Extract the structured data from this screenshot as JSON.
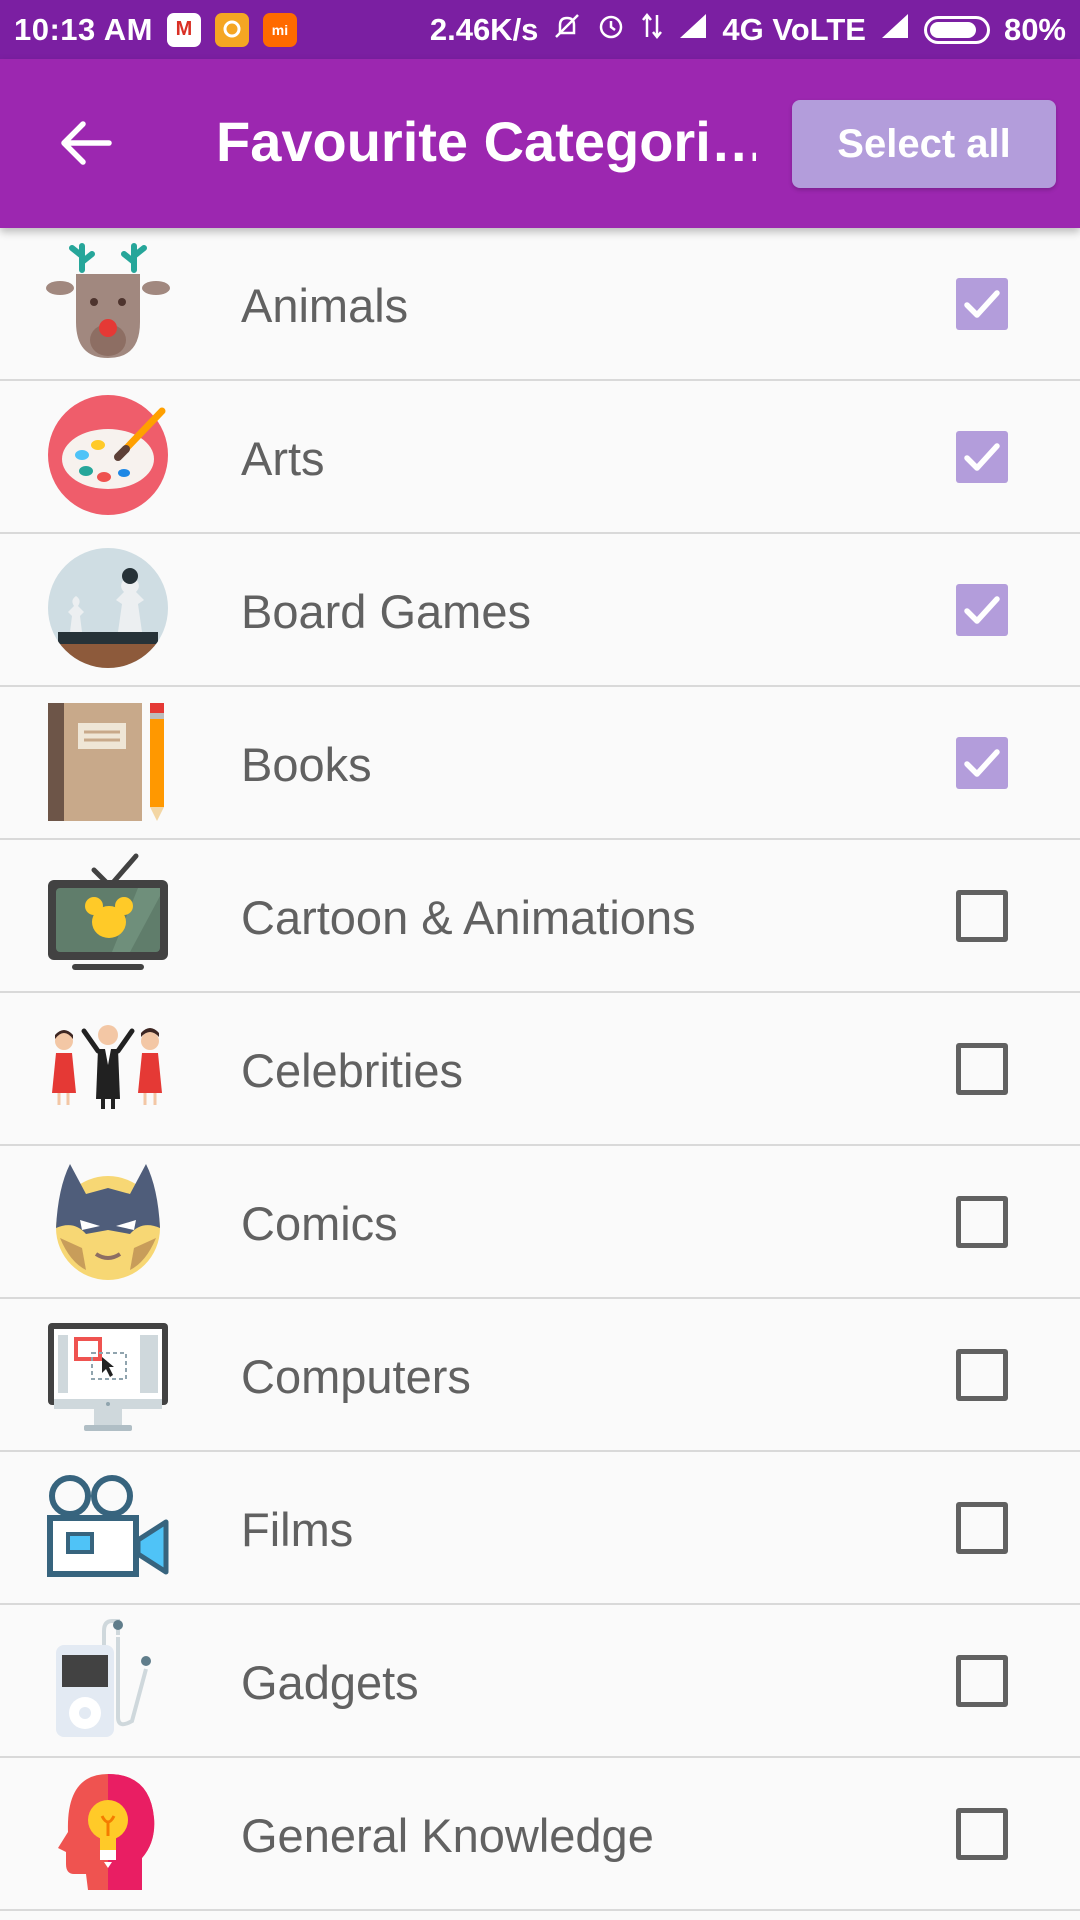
{
  "status_bar": {
    "time": "10:13 AM",
    "network_speed": "2.46K/s",
    "network_type": "4G VoLTE",
    "battery": "80%",
    "battery_level": 0.8
  },
  "toolbar": {
    "title": "Favourite Categori…",
    "select_all_label": "Select all"
  },
  "categories": [
    {
      "label": "Animals",
      "checked": true,
      "icon": "reindeer-icon"
    },
    {
      "label": "Arts",
      "checked": true,
      "icon": "paint-palette-icon"
    },
    {
      "label": "Board Games",
      "checked": true,
      "icon": "chess-icon"
    },
    {
      "label": "Books",
      "checked": true,
      "icon": "book-pencil-icon"
    },
    {
      "label": "Cartoon & Animations",
      "checked": false,
      "icon": "cartoon-tv-icon"
    },
    {
      "label": "Celebrities",
      "checked": false,
      "icon": "celebrities-icon"
    },
    {
      "label": "Comics",
      "checked": false,
      "icon": "superhero-mask-icon"
    },
    {
      "label": "Computers",
      "checked": false,
      "icon": "computer-monitor-icon"
    },
    {
      "label": "Films",
      "checked": false,
      "icon": "film-camera-icon"
    },
    {
      "label": "Gadgets",
      "checked": false,
      "icon": "music-player-icon"
    },
    {
      "label": "General Knowledge",
      "checked": false,
      "icon": "head-lightbulb-icon"
    }
  ],
  "colors": {
    "status_bar": "#7b1fa2",
    "toolbar": "#9c27b0",
    "accent": "#b39ddb",
    "label_text": "#616161"
  }
}
